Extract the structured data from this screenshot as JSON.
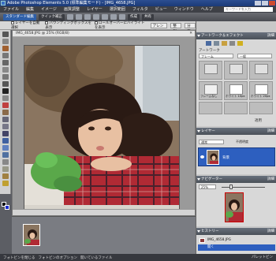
{
  "app": {
    "title": "Adobe Photoshop Elements 5.0 (標準編集モード) - [IMG_4658.JPG]",
    "search_placeholder": "キーワードを入力"
  },
  "menu": [
    "ファイル",
    "編集",
    "イメージ",
    "画質調整",
    "レイヤー",
    "選択範囲",
    "フィルタ",
    "ビュー",
    "ウィンドウ",
    "ヘルプ"
  ],
  "shortcuts": {
    "mode_label": "スタンダード編集",
    "quick_fix": "クイック補正",
    "create": "作成",
    "share": "共有"
  },
  "options": {
    "auto_select": "レイヤーを自動選択",
    "show_bbox": "バウンディングボックスを表示",
    "rollover": "ロールオーバーにハイライトを表示",
    "arrange": "アレンジ",
    "align": "整列",
    "distribute": "分布"
  },
  "document": {
    "title": "IMG_4658.JPG @ 25% (RGB/8)",
    "close": "✕"
  },
  "photobin": {
    "thumb_label": "IMG_4658.JPG"
  },
  "status": {
    "left1": "フォトビンを閉じる",
    "left2": "フォトビンのオプション",
    "left3": "開いているファイル",
    "right": "パレットビン"
  },
  "panels": {
    "artwork": {
      "title": "アートワーク＆エフェクト",
      "more": "詳細",
      "section": "アートワーク",
      "dropdown1": "フレーム",
      "dropdown2": "一般",
      "cells": [
        "",
        "",
        "",
        "フレームなし",
        "ホワイト 10px",
        "ホワイト 20px"
      ],
      "apply": "適用"
    },
    "layers": {
      "title": "レイヤー",
      "more": "詳細",
      "mode": "通常",
      "opacity_label": "不透明度",
      "layer_name": "背景"
    },
    "navigator": {
      "title": "ナビゲーター",
      "more": "詳細",
      "zoom": "25%"
    },
    "history": {
      "title": "ヒストリー",
      "more": "詳細",
      "items": [
        "IMG_4658.JPG",
        "開く"
      ]
    }
  },
  "colors": {
    "accent": "#2d5fbf",
    "foreground": "#000000",
    "background": "#1a2ccc"
  }
}
